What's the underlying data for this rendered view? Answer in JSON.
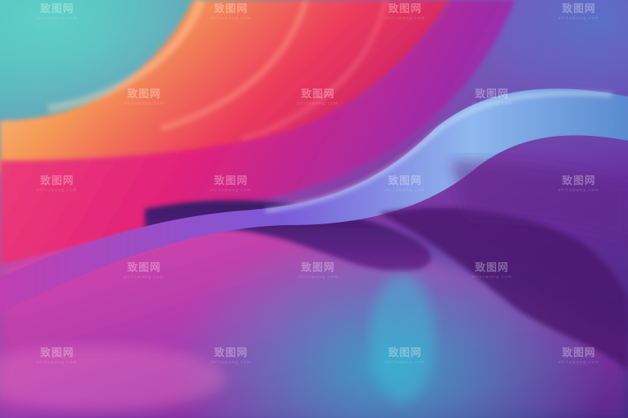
{
  "watermark": {
    "main_text": "致图网",
    "sub_text": "zhituwang.com"
  },
  "palette": {
    "teal": "#3fb7b0",
    "orange": "#f59a57",
    "red": "#ec3b5c",
    "magenta": "#e2237a",
    "violet": "#8b2fb5",
    "indigo": "#4a2aa0",
    "light_blue": "#8fb8ee",
    "deep_purple": "#4b1a6e",
    "cyan": "#35a9c9"
  }
}
